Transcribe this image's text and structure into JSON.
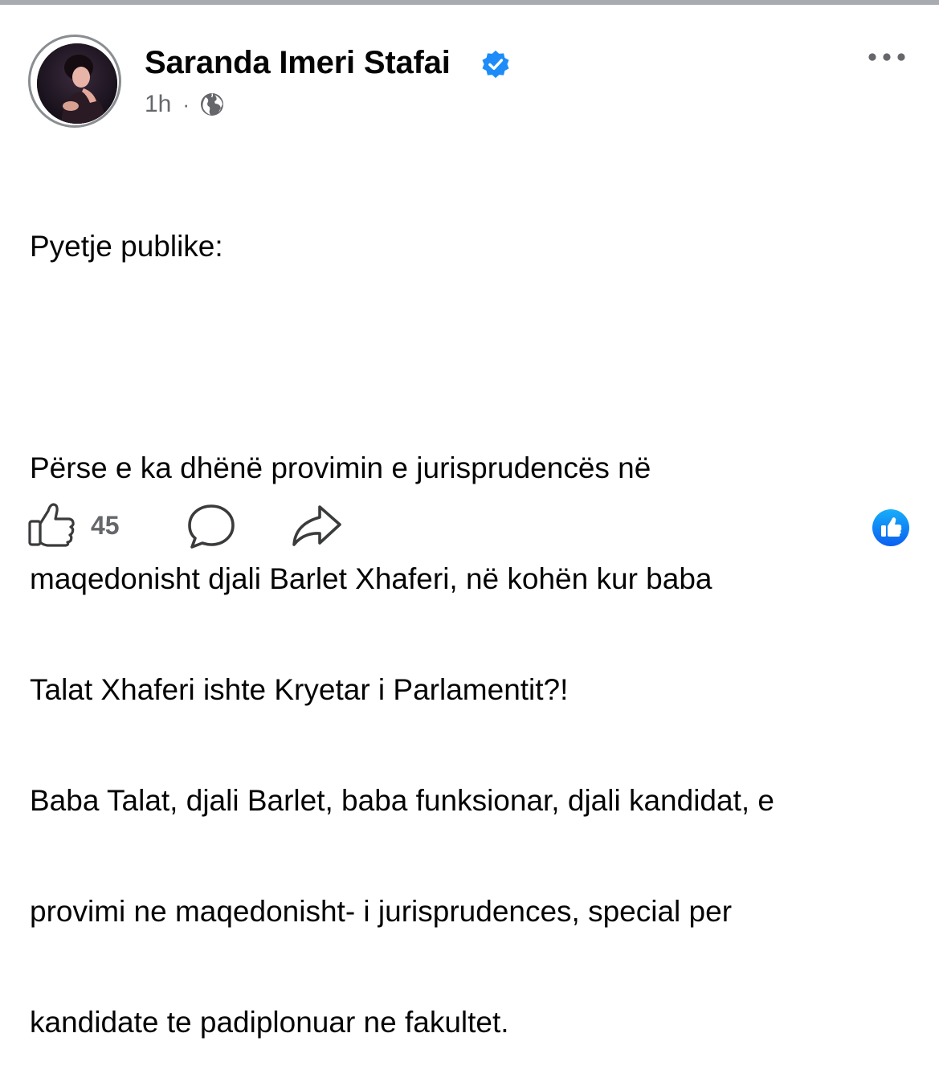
{
  "post": {
    "author": "Saranda Imeri Stafai",
    "verified": true,
    "time": "1h",
    "separator": "·",
    "audience_icon": "globe-icon",
    "more_icon": "more-options-icon",
    "paragraphs": [
      "Pyetje publike:",
      "",
      "Përse e ka dhënë provimin e jurisprudencës në",
      "maqedonisht djali Barlet Xhaferi, në kohën kur baba",
      "Talat Xhaferi ishte Kryetar i Parlamentit?!",
      "Baba Talat, djali Barlet, baba funksionar, djali kandidat, e",
      "provimi ne maqedonisht- i jurisprudences, special per",
      "kandidate te padiplonuar ne fakultet."
    ]
  },
  "actions": {
    "like_icon": "thumbs-up-icon",
    "like_count": "45",
    "comment_icon": "comment-icon",
    "share_icon": "share-icon",
    "reaction_icon": "like-reaction-icon"
  },
  "colors": {
    "accent": "#1877f2",
    "verified_badge": "#1d8cf8",
    "secondary_text": "#65676b",
    "icon_gray": "#65676b"
  }
}
